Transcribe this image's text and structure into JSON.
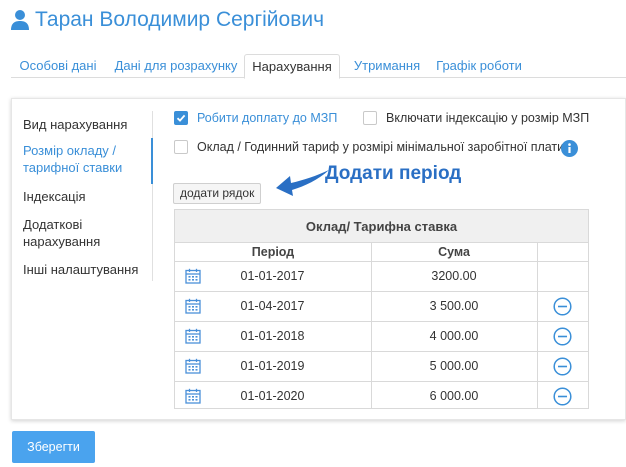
{
  "header": {
    "title": "Таран Володимир Сергійович"
  },
  "tabs": [
    {
      "label": "Особові дані",
      "active": false
    },
    {
      "label": "Дані для розрахунку",
      "active": false
    },
    {
      "label": "Нарахування",
      "active": true
    },
    {
      "label": "Утримання",
      "active": false
    },
    {
      "label": "Графік роботи",
      "active": false
    }
  ],
  "sidebar": {
    "items": [
      {
        "label": "Вид нарахування"
      },
      {
        "label": "Розмір окладу / тарифної ставки",
        "active": true
      },
      {
        "label": "Індексація"
      },
      {
        "label": "Додаткові нарахування"
      },
      {
        "label": "Інші налаштування"
      }
    ]
  },
  "options": {
    "min_wage_supplement": {
      "label": "Робити доплату до МЗП",
      "checked": true
    },
    "include_indexation": {
      "label": "Включати індексацію у розмір МЗП",
      "checked": false
    },
    "min_wage_salary": {
      "label": "Оклад / Годинний тариф у розмірі мінімальної заробітної плати",
      "checked": false
    }
  },
  "add_row_label": "додати рядок",
  "hint_text": "Додати період",
  "table": {
    "title": "Оклад/ Тарифна ставка",
    "columns": {
      "period": "Період",
      "amount": "Сума"
    },
    "rows": [
      {
        "period": "01-01-2017",
        "amount": "3200.00",
        "removable": false
      },
      {
        "period": "01-04-2017",
        "amount": "3 500.00",
        "removable": true
      },
      {
        "period": "01-01-2018",
        "amount": "4 000.00",
        "removable": true
      },
      {
        "period": "01-01-2019",
        "amount": "5 000.00",
        "removable": true
      },
      {
        "period": "01-01-2020",
        "amount": "6 000.00",
        "removable": true
      }
    ]
  },
  "save_label": "Зберегти",
  "colors": {
    "accent": "#3a8fd8",
    "button": "#4aa3ee",
    "hint": "#2a6fc4"
  },
  "icons": [
    "user-icon",
    "check-icon",
    "info-icon",
    "arrow-left-icon",
    "calendar-icon",
    "minus-circle-icon"
  ]
}
